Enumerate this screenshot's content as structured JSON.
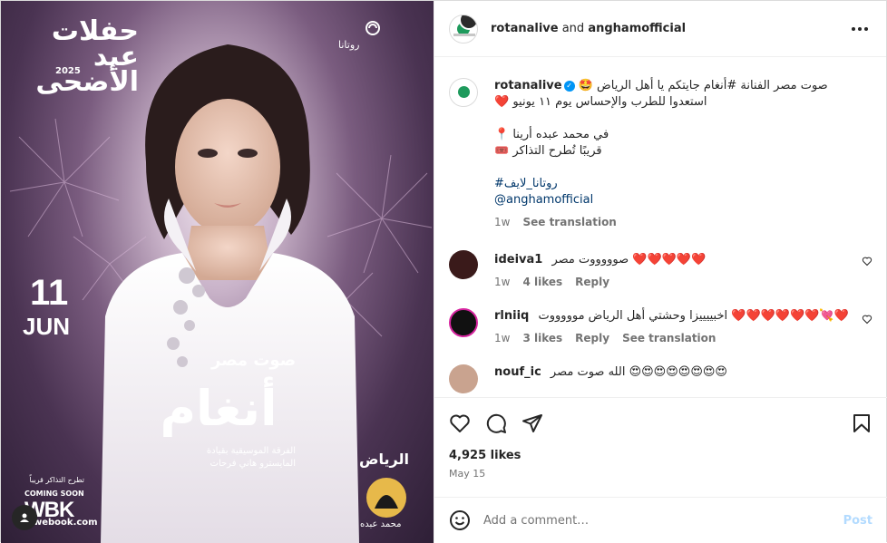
{
  "poster": {
    "eid_title_line1": "حفلات",
    "eid_title_line2": "عيد الأضحى",
    "eid_year": "2025",
    "brand": "روتانا",
    "day": "11",
    "month": "JUN",
    "name_sub": "صوت مصر",
    "name_main": "أنغام",
    "orchestra_line1": "الفرقة الموسيقية بقيادة",
    "orchestra_line2": "المايسترو هاني فرحات",
    "city": "الرياض",
    "arena_label": "محمد عبده",
    "tickets_soon": "تطرح التذاكر قريباً",
    "coming_soon": "COMING SOON",
    "webook": "WBK",
    "webook_url": "webook.com"
  },
  "header": {
    "user1": "rotanalive",
    "and": "and",
    "user2": "anghamofficial"
  },
  "caption": {
    "user": "rotanalive",
    "line1": "صوت مصر الفنانة #أنغام جايتكم يا أهل الرياض 🤩",
    "line2": "استعدوا للطرب والإحساس يوم ١١ يونيو ❤️",
    "line3": "في محمد عبده أرينا 📍",
    "line4": "قريبًا تُطرح التذاكر 🎟️",
    "hashtag": "#روتانا_لايف",
    "mention": "@anghamofficial",
    "time": "1w",
    "see_translation": "See translation"
  },
  "comments": [
    {
      "user": "ideiva1",
      "text": "صوووووت مصر ❤️❤️❤️❤️❤️",
      "time": "1w",
      "likes": "4 likes",
      "reply": "Reply"
    },
    {
      "user": "rlniiq",
      "text": "اخبييييزا وحشتي أهل الرياض موووووت ❤️❤️❤️❤️❤️❤️💘❤️",
      "time": "1w",
      "likes": "3 likes",
      "reply": "Reply",
      "see_translation": "See translation"
    },
    {
      "user": "nouf_ic",
      "text": "الله صوت مصر 😍😍😍😍😍😍😍😍"
    }
  ],
  "engagement": {
    "likes": "4,925 likes",
    "date": "May 15"
  },
  "comment_box": {
    "placeholder": "Add a comment…",
    "post": "Post"
  },
  "colors": {
    "link": "#00376b",
    "verified": "#0095f6",
    "muted": "#737373",
    "heart": "#ed4956"
  }
}
